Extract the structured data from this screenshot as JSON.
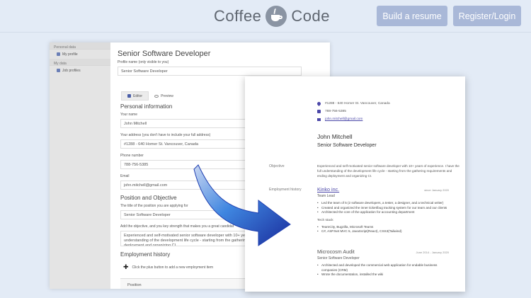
{
  "brand": {
    "left_word": "Coffee",
    "right_word": "Code"
  },
  "header_buttons": {
    "build_resume": "Build a resume",
    "register_login": "Register/Login"
  },
  "colors": {
    "accent": "#a9b8d8",
    "link": "#4b47a8",
    "arrow": "#2a63c9"
  },
  "sidebar": {
    "group_personal": "Personal data",
    "my_profile": "My profile",
    "group_my_data": "My data",
    "job_profiles": "Job profiles"
  },
  "editor": {
    "title": "Senior Software Developer",
    "profile_name_label": "Profile name (only visible to you)",
    "profile_name_value": "Senior Software Developer",
    "tabs": {
      "editor": "Editor",
      "preview": "Preview"
    },
    "personal_info_title": "Personal information",
    "name_label": "Your name",
    "name_value": "John Mitchell",
    "address_label": "Your address (you don't have to include your full address)",
    "address_value": "#1288 - 640 Homer St. Vancouver, Canada",
    "phone_label": "Phone number",
    "phone_value": "788-756-5385",
    "email_label": "Email",
    "email_value": "john.mitchell@gmail.com",
    "position_section_title": "Position and Objective",
    "position_label": "The title of the position you are applying for",
    "position_value": "Senior Software Developer",
    "objective_label": "Add the objective, and you key strength that makes you a great candidat",
    "objective_value": "Experienced and self-motivated senior software developer with 10+ years of experience. I have the full understanding of the development life cycle - starting from the gathering requirements and ending deployment and organizing CI.",
    "employment_title": "Employment history",
    "add_employment_hint": "Click the plus button to add a new employment item",
    "position_column": "Position"
  },
  "resume": {
    "contact": {
      "address": "#1288 - 640 Homer St. Vancouver, Canada",
      "phone": "788-756-5385",
      "email": "john.mitchell@gmail.com"
    },
    "name": "John Mitchell",
    "title": "Senior Software Developer",
    "objective_label": "Objective",
    "objective_text": "Experienced and self-motivated senior software developer with 10+ years of experience. I have the full understanding of the development life cycle - starting from the gathering requirements and ending deployment and organizing CI.",
    "employment_label": "Employment history",
    "jobs": [
      {
        "company": "Kinko inc.",
        "dates": "since January 2020",
        "role": "Team Lead",
        "bullets": [
          "Led the team of 5 (2 software developers, a tester, a designer, and a technical writer)",
          "Created and organized the inner ticket/bug tracking system for our team and our clients",
          "Architected the core of the application for accounting department"
        ],
        "tech_title": "Tech stack",
        "tech": [
          "TeamCity, Bugzilla, Microsoft Teams",
          "C#, ASP.Net MVC 5, JavaScript(React), CSS3(Tailwind)"
        ]
      },
      {
        "company": "Microcosm Audit",
        "dates": "June 2014 - January 2020",
        "role": "Senior Software Developer",
        "bullets": [
          "Architected and developed the commercial web application for endable business companies (CRM)",
          "Wrote the documentation, installed the wiki"
        ]
      }
    ]
  }
}
